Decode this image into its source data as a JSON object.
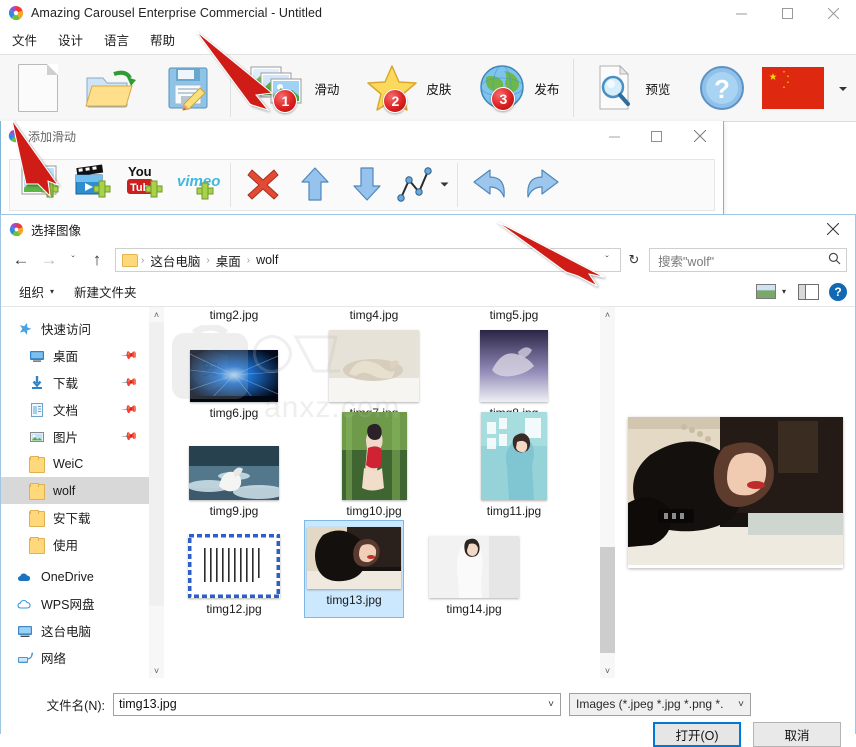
{
  "app": {
    "title": "Amazing Carousel Enterprise Commercial - Untitled",
    "logo_icon": "carousel-logo-icon",
    "window_controls": [
      {
        "name": "minimize-button",
        "glyph": "—"
      },
      {
        "name": "maximize-button",
        "glyph": "☐"
      },
      {
        "name": "close-button",
        "glyph": "✕"
      }
    ],
    "menu": [
      {
        "label": "文件"
      },
      {
        "label": "设计"
      },
      {
        "label": "语言"
      },
      {
        "label": "帮助"
      }
    ],
    "toolbar": [
      {
        "label": "",
        "icon": "new-document-icon",
        "badge": ""
      },
      {
        "label": "",
        "icon": "open-folder-icon",
        "badge": ""
      },
      {
        "label": "",
        "icon": "save-disk-icon",
        "badge": ""
      },
      {
        "label": "滑动",
        "icon": "slides-icon",
        "badge": "1"
      },
      {
        "label": "皮肤",
        "icon": "star-skin-icon",
        "badge": "2"
      },
      {
        "label": "发布",
        "icon": "globe-publish-icon",
        "badge": "3"
      },
      {
        "label": "预览",
        "icon": "preview-magnifier-icon",
        "badge": ""
      },
      {
        "label": "",
        "icon": "help-question-icon",
        "badge": ""
      },
      {
        "label": "",
        "icon": "china-flag-icon",
        "badge": ""
      },
      {
        "label": "",
        "icon": "chevron-down-icon",
        "badge": ""
      }
    ]
  },
  "slide_window": {
    "title": "添加滑动",
    "logo_icon": "carousel-logo-icon",
    "window_controls": [
      {
        "name": "minimize-button",
        "glyph": "—"
      },
      {
        "name": "maximize-button",
        "glyph": "☐"
      },
      {
        "name": "close-button",
        "glyph": "✕"
      }
    ],
    "toolbar": [
      {
        "name": "add-image-button",
        "icon": "add-image-icon"
      },
      {
        "name": "add-video-button",
        "icon": "add-video-icon"
      },
      {
        "name": "add-youtube-button",
        "icon": "youtube-add-icon"
      },
      {
        "name": "add-vimeo-button",
        "icon": "vimeo-add-icon"
      },
      {
        "name": "delete-button",
        "icon": "red-cross-delete-icon"
      },
      {
        "name": "move-up-button",
        "icon": "arrow-up-icon"
      },
      {
        "name": "move-down-button",
        "icon": "arrow-down-icon"
      },
      {
        "name": "transition-button",
        "icon": "polyline-chart-icon"
      },
      {
        "name": "transition-dropdown",
        "icon": "chevron-down-icon"
      },
      {
        "name": "undo-button",
        "icon": "undo-arrow-icon"
      },
      {
        "name": "redo-button",
        "icon": "redo-arrow-icon"
      }
    ]
  },
  "dialog": {
    "title": "选择图像",
    "logo_icon": "carousel-logo-icon",
    "close_glyph": "✕",
    "nav": {
      "back_glyph": "←",
      "forward_glyph": "→",
      "recent_glyph": "ˇ",
      "up_glyph": "↑",
      "refresh_glyph": "↻",
      "dropdown_glyph": "ˇ"
    },
    "breadcrumbs": [
      "这台电脑",
      "桌面",
      "wolf"
    ],
    "breadcrumb_sep": "›",
    "search": {
      "placeholder": "搜索\"wolf\"",
      "value": "",
      "icon": "search-icon"
    },
    "commandbar": {
      "organize": "组织",
      "new_folder": "新建文件夹",
      "view_icon": "view-mode-icon",
      "view_caret": "▾",
      "pane_icon": "preview-pane-icon",
      "help_icon": "help-icon",
      "help_glyph": "?"
    },
    "nav_pane": [
      {
        "label": "快速访问",
        "icon": "quick-access-star-icon",
        "level": 0,
        "pinned": false,
        "selected": false
      },
      {
        "label": "桌面",
        "icon": "desktop-icon",
        "level": 1,
        "pinned": true,
        "selected": false
      },
      {
        "label": "下载",
        "icon": "downloads-icon",
        "level": 1,
        "pinned": true,
        "selected": false
      },
      {
        "label": "文档",
        "icon": "documents-icon",
        "level": 1,
        "pinned": true,
        "selected": false
      },
      {
        "label": "图片",
        "icon": "pictures-icon",
        "level": 1,
        "pinned": true,
        "selected": false
      },
      {
        "label": "WeiC",
        "icon": "folder-icon",
        "level": 1,
        "pinned": false,
        "selected": false
      },
      {
        "label": "wolf",
        "icon": "folder-icon",
        "level": 1,
        "pinned": false,
        "selected": true
      },
      {
        "label": "安下载",
        "icon": "folder-icon",
        "level": 1,
        "pinned": false,
        "selected": false
      },
      {
        "label": "使用",
        "icon": "folder-icon",
        "level": 1,
        "pinned": false,
        "selected": false
      },
      {
        "label": "OneDrive",
        "icon": "onedrive-cloud-icon",
        "level": 0,
        "pinned": false,
        "selected": false
      },
      {
        "label": "WPS网盘",
        "icon": "wps-cloud-icon",
        "level": 0,
        "pinned": false,
        "selected": false
      },
      {
        "label": "这台电脑",
        "icon": "this-pc-icon",
        "level": 0,
        "pinned": false,
        "selected": false
      },
      {
        "label": "网络",
        "icon": "network-icon",
        "level": 0,
        "pinned": false,
        "selected": false
      }
    ],
    "files": [
      {
        "name": "timg2.jpg",
        "thumb": "none",
        "selected": false
      },
      {
        "name": "timg4.jpg",
        "thumb": "none",
        "selected": false
      },
      {
        "name": "timg5.jpg",
        "thumb": "none",
        "selected": false
      },
      {
        "name": "timg6.jpg",
        "thumb": "blue-rays",
        "selected": false
      },
      {
        "name": "timg7.jpg",
        "thumb": "horse-snow",
        "selected": false
      },
      {
        "name": "timg8.jpg",
        "thumb": "purple-horse",
        "selected": false
      },
      {
        "name": "timg9.jpg",
        "thumb": "white-horse-sea",
        "selected": false
      },
      {
        "name": "timg10.jpg",
        "thumb": "red-dress-forest",
        "selected": false
      },
      {
        "name": "timg11.jpg",
        "thumb": "teal-room",
        "selected": false
      },
      {
        "name": "timg12.jpg",
        "thumb": "calligraphy",
        "selected": false
      },
      {
        "name": "timg13.jpg",
        "thumb": "black-dress",
        "selected": true
      },
      {
        "name": "timg14.jpg",
        "thumb": "white-dress",
        "selected": false
      }
    ],
    "preview": {
      "file": "timg13.jpg",
      "alt": "preview-image"
    },
    "scrollbars": {
      "up_glyph": "˄",
      "down_glyph": "˅"
    },
    "bottom": {
      "filename_label": "文件名(N):",
      "filename_value": "timg13.jpg",
      "filename_caret": "˅",
      "filter_value": "Images (*.jpeg *.jpg *.png *.",
      "filter_caret": "˅",
      "open_button": "打开(O)",
      "cancel_button": "取消"
    }
  },
  "annotations": {
    "arrow_color": "#d01a14",
    "arrows": [
      {
        "name": "arrow-to-slides-button"
      },
      {
        "name": "arrow-to-add-image-button"
      },
      {
        "name": "arrow-to-address-bar"
      }
    ]
  },
  "watermark": {
    "text": "anxz.com",
    "glyph": "安"
  }
}
